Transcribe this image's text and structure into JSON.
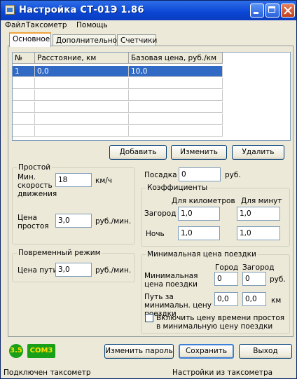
{
  "window": {
    "title": "Настройка СТ-01Э 1.86"
  },
  "menu": [
    "Файл",
    "Таксометр",
    "Помощь"
  ],
  "tabs": [
    "Основное",
    "Дополнительное",
    "Счетчики"
  ],
  "table": {
    "headers": [
      "№",
      "Расстояние, км",
      "Базовая цена, руб./км"
    ],
    "rows": [
      [
        "1",
        "0,0",
        "10,0"
      ],
      [
        "",
        "",
        ""
      ],
      [
        "",
        "",
        ""
      ],
      [
        "",
        "",
        ""
      ],
      [
        "",
        "",
        ""
      ],
      [
        "",
        "",
        ""
      ],
      [
        "",
        "",
        ""
      ]
    ]
  },
  "grid_buttons": {
    "add": "Добавить",
    "edit": "Изменить",
    "delete": "Удалить"
  },
  "idle": {
    "legend": "Простой",
    "min_speed_label": "Мин. скорость движения",
    "min_speed_value": "18",
    "min_speed_unit": "км/ч",
    "price_label": "Цена простоя",
    "price_value": "3,0",
    "price_unit": "руб./мин."
  },
  "boarding": {
    "label": "Посадка",
    "value": "0",
    "unit": "руб."
  },
  "coefficients": {
    "legend": "Коэффициенты",
    "col_km": "Для километров",
    "col_min": "Для минут",
    "rows": [
      {
        "label": "Загород",
        "km": "1,0",
        "min": "1,0"
      },
      {
        "label": "Ночь",
        "km": "1,0",
        "min": "1,0"
      }
    ]
  },
  "time_mode": {
    "legend": "Повременный режим",
    "label": "Цена пути",
    "value": "3,0",
    "unit": "руб./мин."
  },
  "min_price": {
    "legend": "Минимальная цена поездки",
    "col_city": "Город",
    "col_out": "Загород",
    "price_label": "Минимальная цена поездки",
    "price_city": "0",
    "price_out": "0",
    "price_unit": "руб.",
    "path_label": "Путь за минимальн. цену поездки",
    "path_city": "0,0",
    "path_out": "0,0",
    "path_unit": "км",
    "include_label": "Включить цену времени простоя в минимальную цену поездки",
    "include_checked": false
  },
  "connection": {
    "badge": "3.5",
    "port": "COM3"
  },
  "footer_buttons": {
    "change_password": "Изменить пароль",
    "save": "Сохранить",
    "exit": "Выход"
  },
  "status": {
    "left": "Подключен таксометр",
    "right": "Настройки из таксометра"
  },
  "colors": {
    "titlebar": "#0a46d4",
    "selection": "#316ac5",
    "badge": "#18a018"
  }
}
